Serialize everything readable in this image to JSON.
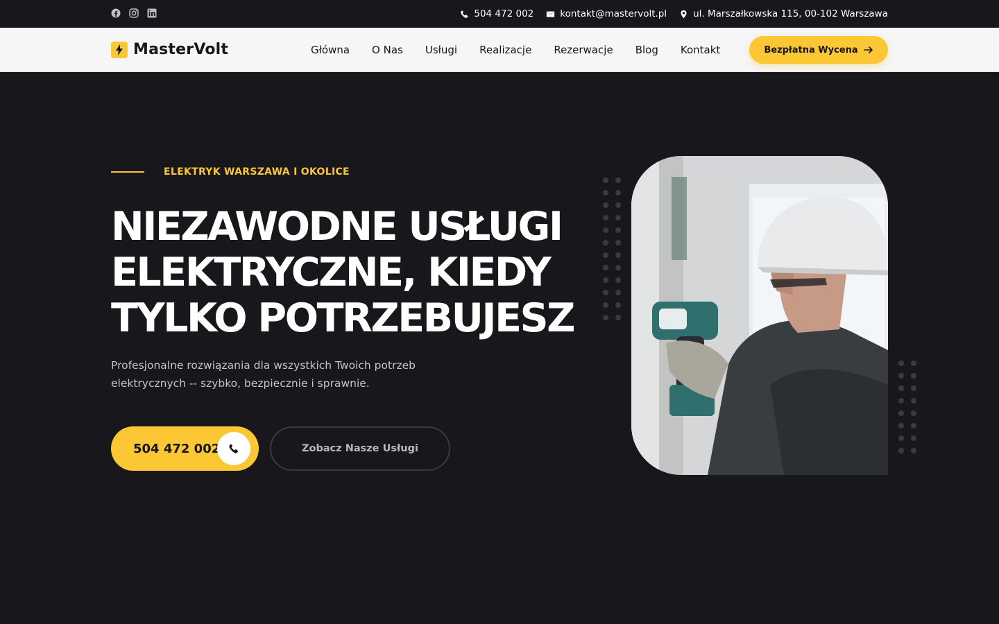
{
  "topbar": {
    "social_icons": [
      "facebook-icon",
      "instagram-icon",
      "linkedin-icon"
    ],
    "phone": "504 472 002",
    "email": "kontakt@mastervolt.pl",
    "address": "ul. Marszałkowska 115, 00-102 Warszawa"
  },
  "nav": {
    "brand": "MasterVolt",
    "items": [
      {
        "label": "Główna"
      },
      {
        "label": "O Nas"
      },
      {
        "label": "Usługi"
      },
      {
        "label": "Realizacje"
      },
      {
        "label": "Rezerwacje"
      },
      {
        "label": "Blog"
      },
      {
        "label": "Kontakt"
      }
    ],
    "cta_label": "Bezpłatna Wycena"
  },
  "hero": {
    "kicker": "ELEKTRYK WARSZAWA I OKOLICE",
    "headline_lines": [
      "NIEZAWODNE USŁUGI",
      "ELEKTRYCZNE, KIEDY",
      "TYLKO POTRZEBUJESZ"
    ],
    "subtitle": "Profesjonalne rozwiązania dla wszystkich Twoich potrzeb elektrycznych -- szybko, bezpiecznie i sprawnie.",
    "phone_button": "504 472 002",
    "services_button": "Zobacz Nasze Usługi"
  },
  "colors": {
    "accent": "#fcc735",
    "background": "#17171c",
    "nav_background": "#f6f6f7"
  }
}
